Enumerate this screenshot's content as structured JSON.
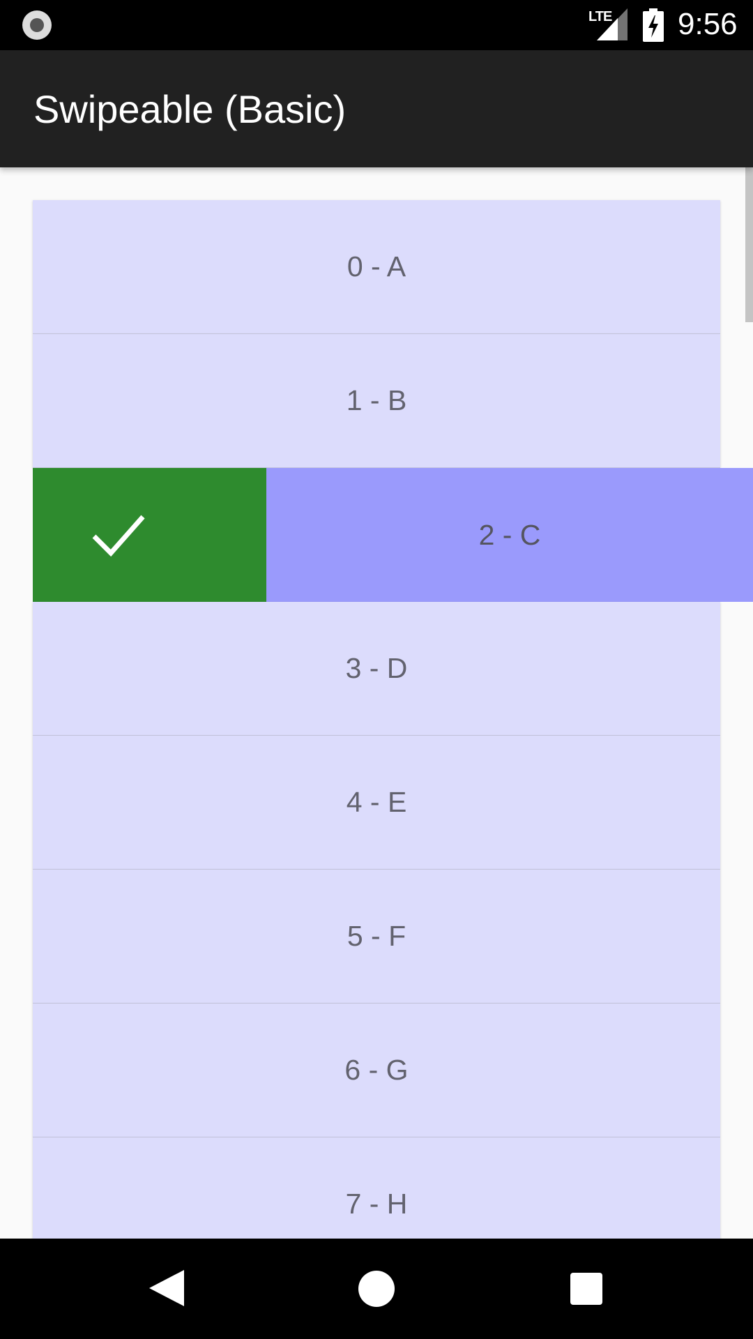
{
  "status_bar": {
    "network_label": "LTE",
    "time": "9:56",
    "icons": [
      "screen-record-icon",
      "lte-signal-icon",
      "battery-charging-icon"
    ]
  },
  "app_bar": {
    "title": "Swipeable (Basic)"
  },
  "list": {
    "items": [
      {
        "label": "0 - A"
      },
      {
        "label": "1 - B"
      },
      {
        "label": "2 - C"
      },
      {
        "label": "3 - D"
      },
      {
        "label": "4 - E"
      },
      {
        "label": "5 - F"
      },
      {
        "label": "6 - G"
      },
      {
        "label": "7 - H"
      }
    ],
    "swiped_item": {
      "action_icon": "check-icon",
      "action_color": "#2e8b2e",
      "content_color": "#9a9afc"
    },
    "item_color": "#dcdcfc"
  },
  "nav_bar": {
    "icons": [
      "back-icon",
      "home-icon",
      "recents-icon"
    ]
  }
}
